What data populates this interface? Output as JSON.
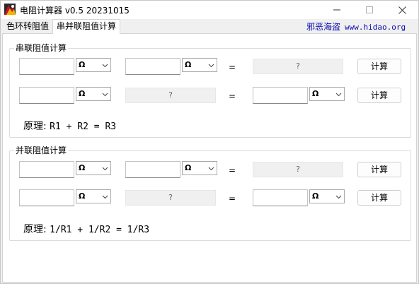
{
  "window": {
    "title": "电阻计算器 v0.5 20231015",
    "min_glyph": "—",
    "max_glyph": "☐",
    "close_glyph": "✕"
  },
  "tabs": [
    {
      "label": "色环转阻值",
      "active": false
    },
    {
      "label": "串并联阻值计算",
      "active": true
    }
  ],
  "site": {
    "name": "邪恶海盗",
    "url": "www.hidao.org"
  },
  "series": {
    "legend": "串联阻值计算",
    "row1": {
      "r1_value": "",
      "r1_unit": "Ω",
      "r2_value": "",
      "r2_unit": "Ω",
      "equals": "=",
      "result": "?",
      "button": "计算"
    },
    "row2": {
      "r1_value": "",
      "r1_unit": "Ω",
      "r2_result": "?",
      "equals": "=",
      "r3_value": "",
      "r3_unit": "Ω",
      "button": "计算"
    },
    "formula_label": "原理:",
    "formula": "R1 + R2 = R3"
  },
  "parallel": {
    "legend": "并联阻值计算",
    "row1": {
      "r1_value": "",
      "r1_unit": "Ω",
      "r2_value": "",
      "r2_unit": "Ω",
      "equals": "=",
      "result": "?",
      "button": "计算"
    },
    "row2": {
      "r1_value": "",
      "r1_unit": "Ω",
      "r2_result": "?",
      "equals": "=",
      "r3_value": "",
      "r3_unit": "Ω",
      "button": "计算"
    },
    "formula_label": "原理:",
    "formula": "1/R1 + 1/R2 = 1/R3"
  },
  "colors": {
    "accent_link": "#0a0ab0",
    "result_bg": "#f0f0f0"
  }
}
